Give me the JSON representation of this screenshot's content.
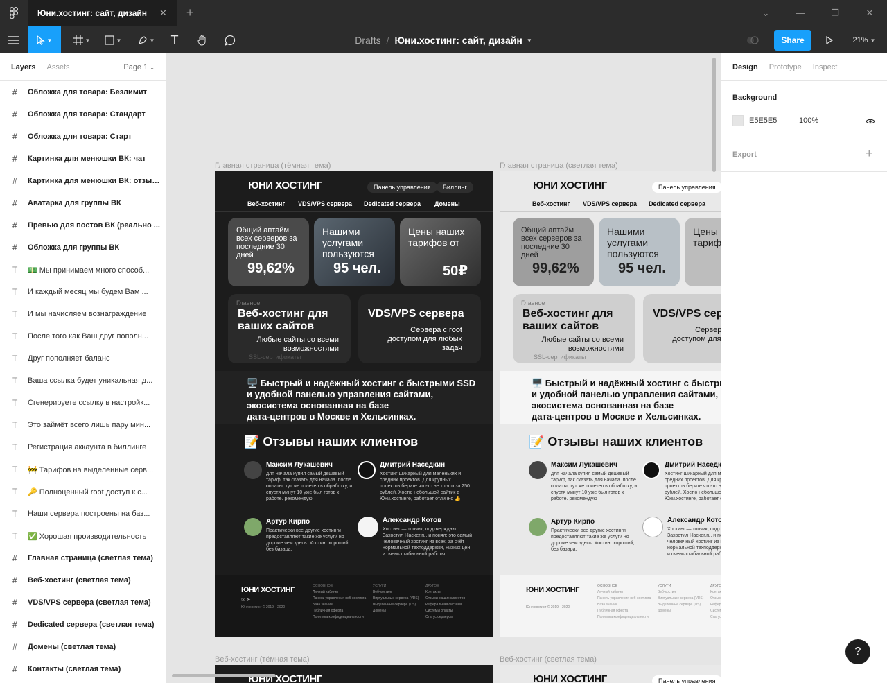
{
  "app": {
    "tab_title": "Юни.хостинг: сайт, дизайн",
    "breadcrumb_root": "Drafts",
    "breadcrumb_sep": "/",
    "file_name": "Юни.хостинг: сайт, дизайн",
    "share_label": "Share",
    "zoom": "21%"
  },
  "left_panel": {
    "tab_layers": "Layers",
    "tab_assets": "Assets",
    "page": "Page 1",
    "layers": [
      {
        "type": "frame",
        "label": "Обложка для товара: Безлимит"
      },
      {
        "type": "frame",
        "label": "Обложка для товара: Стандарт"
      },
      {
        "type": "frame",
        "label": "Обложка для товара: Старт"
      },
      {
        "type": "frame",
        "label": "Картинка для менюшки ВК: чат"
      },
      {
        "type": "frame",
        "label": "Картинка для менюшки ВК: отзывы"
      },
      {
        "type": "frame",
        "label": "Аватарка для группы ВК"
      },
      {
        "type": "frame",
        "label": "Превью для постов ВК (реально ..."
      },
      {
        "type": "frame",
        "label": "Обложка для группы ВК"
      },
      {
        "type": "text",
        "label": "💵 Мы принимаем много способ..."
      },
      {
        "type": "text",
        "label": "И каждый месяц мы будем Вам ..."
      },
      {
        "type": "text",
        "label": "И мы начисляем вознаграждение"
      },
      {
        "type": "text",
        "label": "После того как Ваш друг пополн..."
      },
      {
        "type": "text",
        "label": "Друг пополняет баланс"
      },
      {
        "type": "text",
        "label": "Ваша ссылка будет уникальная д..."
      },
      {
        "type": "text",
        "label": "Сгенерируете ссылку в настройк..."
      },
      {
        "type": "text",
        "label": "Это займёт всего лишь пару мин..."
      },
      {
        "type": "text",
        "label": "Регистрация аккаунта в биллинге"
      },
      {
        "type": "text",
        "label": "🚧 Тарифов на выделенные серв..."
      },
      {
        "type": "text",
        "label": "🔑 Полноценный root доступ к с..."
      },
      {
        "type": "text",
        "label": "Наши сервера построены на баз..."
      },
      {
        "type": "text",
        "label": "✅ Хорошая производительность"
      },
      {
        "type": "frame",
        "label": "Главная страница (светлая тема)"
      },
      {
        "type": "frame",
        "label": "Веб-хостинг (светлая тема)"
      },
      {
        "type": "frame",
        "label": "VDS/VPS сервера (светлая тема)"
      },
      {
        "type": "frame",
        "label": "Dedicated сервера (светлая тема)"
      },
      {
        "type": "frame",
        "label": "Домены (светлая тема)"
      },
      {
        "type": "frame",
        "label": "Контакты (светлая тема)"
      }
    ]
  },
  "right_panel": {
    "tab_design": "Design",
    "tab_prototype": "Prototype",
    "tab_inspect": "Inspect",
    "background_label": "Background",
    "background_hex": "E5E5E5",
    "background_opacity": "100%",
    "export_label": "Export"
  },
  "canvas": {
    "frame_dark_label": "Главная страница (тёмная тема)",
    "frame_light_label": "Главная страница (светлая тема)",
    "frame_web_dark_label": "Веб-хостинг (тёмная тема)",
    "frame_web_light_label": "Веб-хостинг (светлая тема)",
    "site": {
      "brand": "ЮНИ ХОСТИНГ",
      "btn_panel": "Панель управления",
      "btn_billing": "Биллинг",
      "nav": [
        "Веб-хостинг",
        "VDS/VPS сервера",
        "Dedicated сервера",
        "Домены"
      ],
      "card1_text": "Общий аптайм всех серверов за последние 30 дней",
      "card1_value": "99,62%",
      "card2_text": "Нашими услугами пользуются",
      "card2_value": "95 чел.",
      "card3_text": "Цены наших тарифов от",
      "card3_value": "50₽",
      "tag_main": "Главное",
      "web_title": "Веб-хостинг для ваших сайтов",
      "web_sub": "Любые сайты со всеми возможностями",
      "web_extra": "SSL-сертификаты",
      "vds_title": "VDS/VPS сервера",
      "vds_sub": "Сервера с root доступом для любых задач",
      "banner_l1": "🖥️ Быстрый и надёжный хостинг с быстрыми SSD",
      "banner_l2": "и удобной панелью управления сайтами,",
      "banner_l3": "экосистема основанная на базе",
      "banner_l4": "дата-центров в Москве и Хельсинках.",
      "reviews_title": "📝 Отзывы наших клиентов",
      "reviews": [
        {
          "name": "Максим Лукашевич",
          "text": "для начала купил самый дешевый тариф, так сказать для начала. после оплаты, тут же полетел в обработку, и спустя минут 10 уже был готов к работе. рекомендую"
        },
        {
          "name": "Дмитрий Наседкин",
          "text": "Хостинг шикарный для маленьких и средних проектов. Для крупных проектов берите что-то не то что за 250 рублей. Хостю небольшой сайтик в Юни.хостинге, работает отлично 👍"
        },
        {
          "name": "Артур Кирпо",
          "text": "Практически все другие хостинги предоставляют такие же услуги но дороже чем здесь. Хостинг хороший, без базара."
        },
        {
          "name": "Александр Котов",
          "text": "Хостинг — топчик, подтверждаю. Захостил l-lacker.ru, и понял: это самый человечный хостинг из всех, за счёт нормальной техподдержки, низких цен и очень стабильной работы."
        }
      ],
      "footer_brand": "ЮНИ ХОСТИНГ",
      "footer_copy": "Юни.хостинг © 2019—2020",
      "footer_cols": [
        {
          "title": "ОСНОВНОЕ",
          "items": [
            "Личный кабинет",
            "Панель управления веб-хостинга",
            "База знаний",
            "Публичная оферта",
            "Политика конфиденциальности"
          ]
        },
        {
          "title": "УСЛУГИ",
          "items": [
            "Веб-хостинг",
            "Виртуальные сервера (VDS)",
            "Выделенные сервера (DS)",
            "Домены"
          ]
        },
        {
          "title": "ДРУГОЕ",
          "items": [
            "Контакты",
            "Отзывы наших клиентов",
            "Реферальная система",
            "Системы оплаты",
            "Статус серверов"
          ]
        }
      ]
    }
  },
  "colors": {
    "accent": "#18a0fb",
    "chrome": "#2c2c2c",
    "canvas_bg": "#E5E5E5"
  }
}
